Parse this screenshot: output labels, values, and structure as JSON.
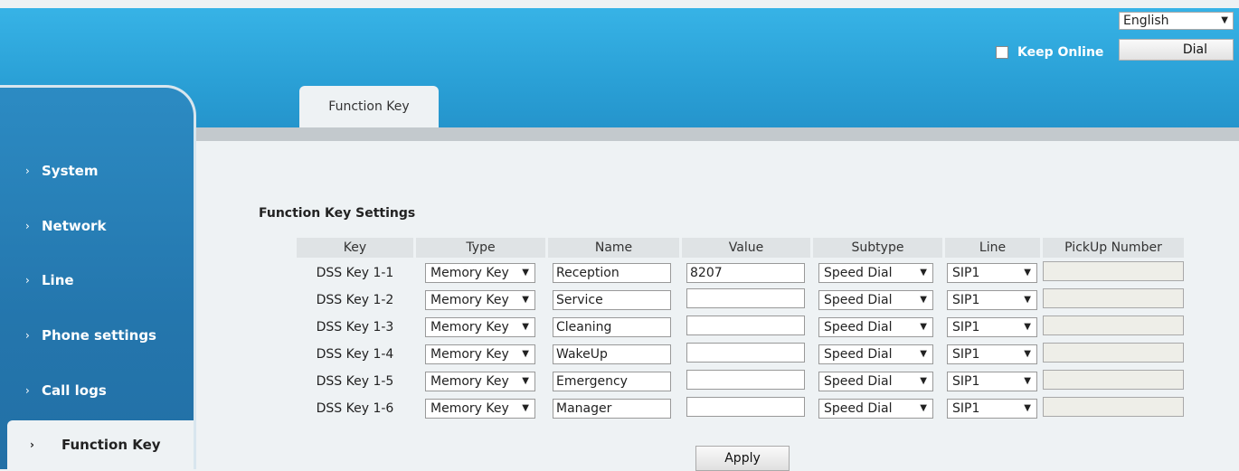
{
  "header": {
    "language": "English",
    "keep_online_label": "Keep Online",
    "dial_label": "Dial"
  },
  "sidebar": {
    "items": [
      {
        "label": "System"
      },
      {
        "label": "Network"
      },
      {
        "label": "Line"
      },
      {
        "label": "Phone settings"
      },
      {
        "label": "Call logs"
      },
      {
        "label": "Function Key",
        "active": true
      }
    ]
  },
  "tabs": [
    {
      "label": "Function Key"
    }
  ],
  "settings": {
    "title": "Function Key Settings",
    "columns": [
      "Key",
      "Type",
      "Name",
      "Value",
      "Subtype",
      "Line",
      "PickUp Number"
    ],
    "rows": [
      {
        "key": "DSS Key 1-1",
        "type": "Memory Key",
        "name": "Reception",
        "value": "8207",
        "subtype": "Speed Dial",
        "line": "SIP1",
        "pickup": ""
      },
      {
        "key": "DSS Key 1-2",
        "type": "Memory Key",
        "name": "Service",
        "value": "",
        "subtype": "Speed Dial",
        "line": "SIP1",
        "pickup": ""
      },
      {
        "key": "DSS Key 1-3",
        "type": "Memory Key",
        "name": "Cleaning",
        "value": "",
        "subtype": "Speed Dial",
        "line": "SIP1",
        "pickup": ""
      },
      {
        "key": "DSS Key 1-4",
        "type": "Memory Key",
        "name": "WakeUp",
        "value": "",
        "subtype": "Speed Dial",
        "line": "SIP1",
        "pickup": ""
      },
      {
        "key": "DSS Key 1-5",
        "type": "Memory Key",
        "name": "Emergency",
        "value": "",
        "subtype": "Speed Dial",
        "line": "SIP1",
        "pickup": ""
      },
      {
        "key": "DSS Key 1-6",
        "type": "Memory Key",
        "name": "Manager",
        "value": "",
        "subtype": "Speed Dial",
        "line": "SIP1",
        "pickup": ""
      }
    ],
    "apply_label": "Apply"
  },
  "colors": {
    "banner": "#2aa0d6",
    "sidebar": "#2476ad",
    "content_bg": "#eef2f4"
  }
}
